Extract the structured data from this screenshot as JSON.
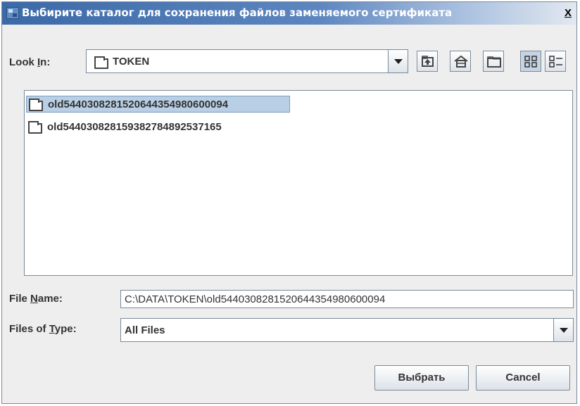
{
  "window": {
    "title": "Выбирите каталог для сохранения файлов заменяемого сертификата",
    "close_label": "X"
  },
  "look_in": {
    "label_pre": "Look ",
    "label_mnemonic": "I",
    "label_post": "n:",
    "value": "TOKEN"
  },
  "toolbar": {
    "icons": [
      "up-one-level-icon",
      "home-icon",
      "new-folder-icon",
      "list-view-icon",
      "details-view-icon"
    ]
  },
  "files": [
    {
      "name": "old5440308281520644354980600094",
      "selected": true
    },
    {
      "name": "old5440308281593827848925371​65",
      "selected": false
    }
  ],
  "file_name": {
    "label_pre": "File ",
    "label_mnemonic": "N",
    "label_post": "ame:",
    "value": "C:\\DATA\\TOKEN\\old5440308281520644354980600094"
  },
  "files_of_type": {
    "label_pre": "Files of ",
    "label_mnemonic": "T",
    "label_post": "ype:",
    "value": "All Files"
  },
  "buttons": {
    "select": "Выбрать",
    "cancel": "Cancel"
  }
}
